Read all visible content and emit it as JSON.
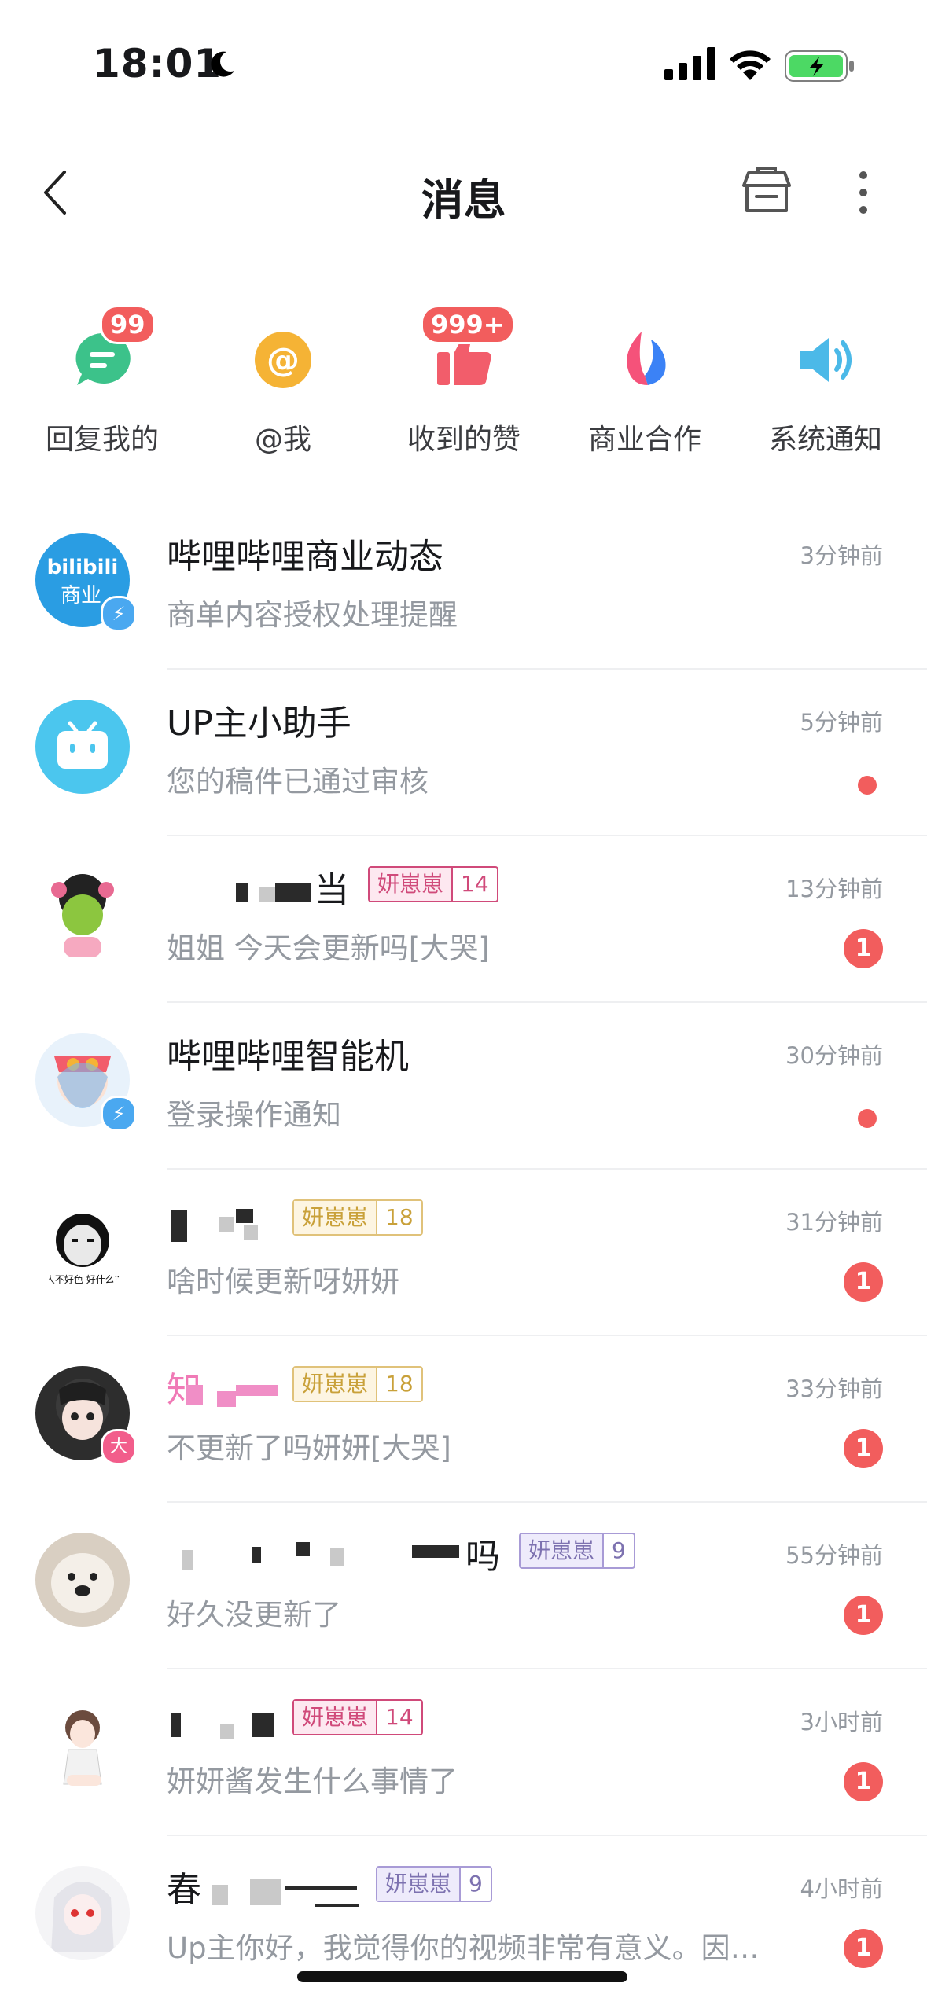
{
  "status_bar": {
    "time": "18:01"
  },
  "header": {
    "title": "消息"
  },
  "categories": [
    {
      "label": "回复我的",
      "badge": "99",
      "icon": "reply-icon",
      "color": "#3cc28a"
    },
    {
      "label": "@我",
      "badge": "",
      "icon": "at-icon",
      "color": "#f5b335"
    },
    {
      "label": "收到的赞",
      "badge": "999+",
      "icon": "like-icon",
      "color": "#f25d6b"
    },
    {
      "label": "商业合作",
      "badge": "",
      "icon": "business-icon",
      "color": "#3b82f6"
    },
    {
      "label": "系统通知",
      "badge": "",
      "icon": "speaker-icon",
      "color": "#4bb9e8"
    }
  ],
  "messages": [
    {
      "name": "哔哩哔哩商业动态",
      "time": "3分钟前",
      "preview": "商单内容授权处理提醒",
      "unread": "",
      "dot": false,
      "avatar_text": "bilibili 商业"
    },
    {
      "name": "UP主小助手",
      "time": "5分钟前",
      "preview": "您的稿件已通过审核",
      "unread": "",
      "dot": true
    },
    {
      "name": "当",
      "fan_tag": "妍崽崽",
      "fan_level": "14",
      "time": "13分钟前",
      "preview": "姐姐 今天会更新吗[大哭]",
      "unread": "1",
      "dot": false
    },
    {
      "name": "哔哩哔哩智能机",
      "time": "30分钟前",
      "preview": "登录操作通知",
      "unread": "",
      "dot": true
    },
    {
      "name": "",
      "fan_tag": "妍崽崽",
      "fan_level": "18",
      "time": "31分钟前",
      "preview": "啥时候更新呀妍妍",
      "unread": "1",
      "dot": false
    },
    {
      "name": "知",
      "fan_tag": "妍崽崽",
      "fan_level": "18",
      "time": "33分钟前",
      "preview": "不更新了吗妍妍[大哭]",
      "unread": "1",
      "dot": false,
      "avatar_badge": "大"
    },
    {
      "name": "吗",
      "fan_tag": "妍崽崽",
      "fan_level": "9",
      "time": "55分钟前",
      "preview": "好久没更新了",
      "unread": "1",
      "dot": false
    },
    {
      "name": "",
      "fan_tag": "妍崽崽",
      "fan_level": "14",
      "time": "3小时前",
      "preview": "妍妍酱发生什么事情了",
      "unread": "1",
      "dot": false
    },
    {
      "name": "春",
      "fan_tag": "妍崽崽",
      "fan_level": "9",
      "time": "4小时前",
      "preview": "Up主你好，我觉得你的视频非常有意义。因…",
      "unread": "1",
      "dot": false
    }
  ],
  "colors": {
    "accent_red": "#f25d5d",
    "gray_text": "#9499a0"
  }
}
